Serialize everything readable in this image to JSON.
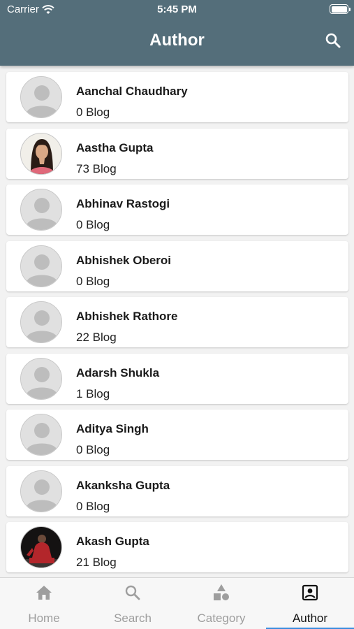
{
  "status_bar": {
    "carrier": "Carrier",
    "time": "5:45 PM"
  },
  "header": {
    "title": "Author",
    "search_icon": "search-icon"
  },
  "authors": [
    {
      "name": "Aanchal Chaudhary",
      "count": "0 Blog",
      "avatar": "placeholder"
    },
    {
      "name": "Aastha Gupta",
      "count": "73 Blog",
      "avatar": "photo-woman"
    },
    {
      "name": "Abhinav Rastogi",
      "count": "0 Blog",
      "avatar": "placeholder"
    },
    {
      "name": "Abhishek Oberoi",
      "count": "0 Blog",
      "avatar": "placeholder"
    },
    {
      "name": "Abhishek Rathore",
      "count": "22 Blog",
      "avatar": "placeholder"
    },
    {
      "name": "Adarsh Shukla",
      "count": "1 Blog",
      "avatar": "placeholder"
    },
    {
      "name": "Aditya Singh",
      "count": "0 Blog",
      "avatar": "placeholder"
    },
    {
      "name": "Akanksha Gupta",
      "count": "0 Blog",
      "avatar": "placeholder"
    },
    {
      "name": "Akash Gupta",
      "count": "21 Blog",
      "avatar": "photo-man"
    }
  ],
  "tabs": [
    {
      "label": "Home",
      "icon": "home-icon",
      "active": false
    },
    {
      "label": "Search",
      "icon": "search-icon",
      "active": false
    },
    {
      "label": "Category",
      "icon": "category-icon",
      "active": false
    },
    {
      "label": "Author",
      "icon": "author-icon",
      "active": true
    }
  ],
  "colors": {
    "header": "#546e7a",
    "active_tab_indicator": "#3a8dde",
    "inactive_tab": "#9e9e9e"
  }
}
